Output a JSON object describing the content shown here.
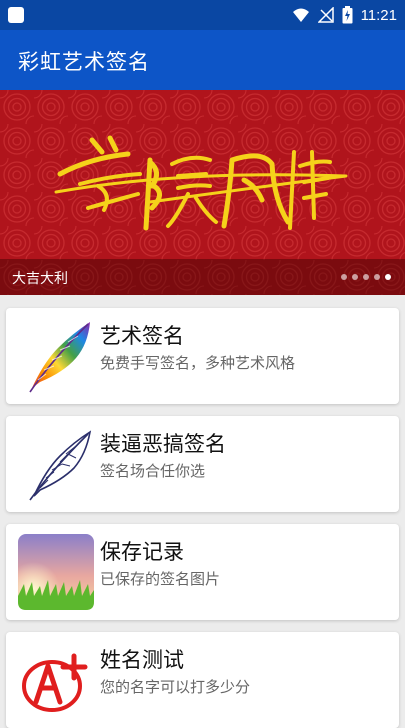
{
  "status_bar": {
    "time": "11:21"
  },
  "app_bar": {
    "title": "彩虹艺术签名"
  },
  "banner": {
    "caption": "大吉大利",
    "signature_text": "兰陵风格",
    "dots_total": 5,
    "active_dot": 4
  },
  "cards": [
    {
      "title": "艺术签名",
      "subtitle": "免费手写签名，多种艺术风格",
      "icon": "rainbow-feather-icon"
    },
    {
      "title": "装逼恶搞签名",
      "subtitle": "签名场合任你选",
      "icon": "feather-quill-icon"
    },
    {
      "title": "保存记录",
      "subtitle": "已保存的签名图片",
      "icon": "sunset-grass-icon"
    },
    {
      "title": "姓名测试",
      "subtitle": "您的名字可以打多少分",
      "icon": "a-plus-grade-icon"
    }
  ],
  "colors": {
    "status_bar": "#0a47a3",
    "app_bar": "#0d55c7",
    "banner_red": "#b0141c",
    "signature_gold": "#f5d21a"
  }
}
